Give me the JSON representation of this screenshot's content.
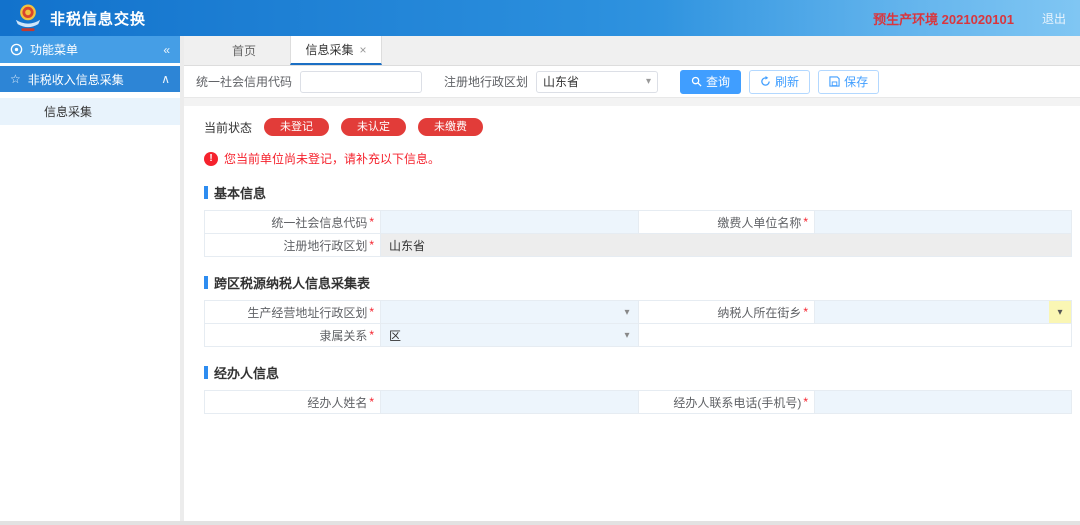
{
  "header": {
    "app_title": "非税信息交换",
    "env_label": "预生产环境 2021020101",
    "logout_label": "退出"
  },
  "sidebar": {
    "menu_header": "功能菜单",
    "collapse_icon": "«",
    "group_label": "非税收入信息采集",
    "items": [
      {
        "label": "信息采集",
        "selected": true
      }
    ]
  },
  "tabs": [
    {
      "label": "首页",
      "active": false
    },
    {
      "label": "信息采集",
      "active": true,
      "close_icon": "×"
    }
  ],
  "search_bar": {
    "credit_code_label": "统一社会信用代码",
    "credit_code_value": "",
    "region_label": "注册地行政区划",
    "region_value": "山东省",
    "query_label": "查询",
    "refresh_label": "刷新",
    "save_label": "保存"
  },
  "status": {
    "label": "当前状态",
    "badges": [
      "未登记",
      "未认定",
      "未缴费"
    ]
  },
  "warning_text": "您当前单位尚未登记，请补充以下信息。",
  "form": {
    "basic": {
      "title": "基本信息",
      "credit_code_label": "统一社会信息代码",
      "credit_code_value": "",
      "payer_name_label": "缴费人单位名称",
      "payer_name_value": "",
      "region_label": "注册地行政区划",
      "region_value": "山东省"
    },
    "cross": {
      "title": "跨区税源纳税人信息采集表",
      "biz_region_label": "生产经营地址行政区划",
      "biz_region_value": "",
      "street_label": "纳税人所在街乡",
      "street_value": "",
      "affiliation_label": "隶属关系",
      "affiliation_value": "区"
    },
    "agent": {
      "title": "经办人信息",
      "name_label": "经办人姓名",
      "name_value": "",
      "phone_label": "经办人联系电话(手机号)",
      "phone_value": ""
    }
  },
  "ui": {
    "required_marker": "*",
    "chevron_down": "▾",
    "chevron_up": "∧",
    "colors": {
      "accent_blue": "#409eff",
      "header_blue": "#1272cc",
      "badge_red": "#e23c39",
      "warning_red": "#f5222d",
      "env_red": "#d9363e",
      "field_blue": "#edf5fc",
      "highlight_yellow": "#faf6b4"
    }
  }
}
